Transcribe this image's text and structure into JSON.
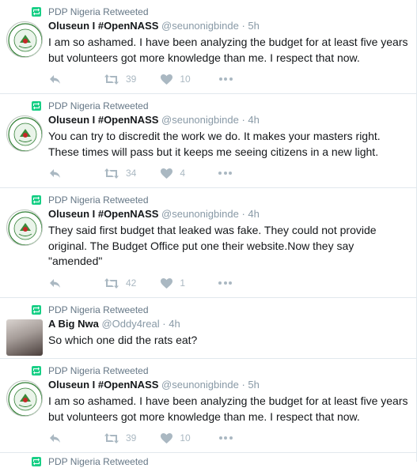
{
  "tweets": [
    {
      "retweeted_by": "PDP Nigeria Retweeted",
      "name": "Oluseun I #OpenNASS",
      "handle": "@seunonigbinde",
      "time": "5h",
      "text": "I am so ashamed. I have been analyzing the budget for at least five years but volunteers got more knowledge than me. I respect that now.",
      "retweets": "39",
      "likes": "10",
      "avatar": "seal-icon"
    },
    {
      "retweeted_by": "PDP Nigeria Retweeted",
      "name": "Oluseun I #OpenNASS",
      "handle": "@seunonigbinde",
      "time": "4h",
      "text": "You can try to discredit the work we do. It makes your masters right. These times will pass but it keeps me seeing citizens in a new light.",
      "retweets": "34",
      "likes": "4",
      "avatar": "seal-icon"
    },
    {
      "retweeted_by": "PDP Nigeria Retweeted",
      "name": "Oluseun I #OpenNASS",
      "handle": "@seunonigbinde",
      "time": "4h",
      "text": "They said first budget that leaked was fake. They could not provide original. The Budget Office put one their website.Now they say \"amended\"",
      "retweets": "42",
      "likes": "1",
      "avatar": "seal-icon"
    },
    {
      "retweeted_by": "PDP Nigeria Retweeted",
      "name": "A Big Nwa",
      "handle": "@Oddy4real",
      "time": "4h",
      "text": "So which one did the rats eat?",
      "retweets": "",
      "likes": "",
      "avatar": "photo"
    },
    {
      "retweeted_by": "PDP Nigeria Retweeted",
      "name": "Oluseun I #OpenNASS",
      "handle": "@seunonigbinde",
      "time": "5h",
      "text": "I am so ashamed. I have been analyzing the budget for at least five years but volunteers got more knowledge than me. I respect that now.",
      "retweets": "39",
      "likes": "10",
      "avatar": "seal-icon"
    }
  ],
  "partial_retweeted_by": "PDP Nigeria Retweeted",
  "colors": {
    "retweet_green": "#19cf86",
    "meta_grey": "#8899a6",
    "action_grey": "#aab8c2",
    "divider": "#e1e8ed"
  },
  "icons": [
    "retweet-badge-icon",
    "reply-icon",
    "retweet-icon",
    "like-heart-icon",
    "more-dots-icon",
    "seal-icon"
  ]
}
